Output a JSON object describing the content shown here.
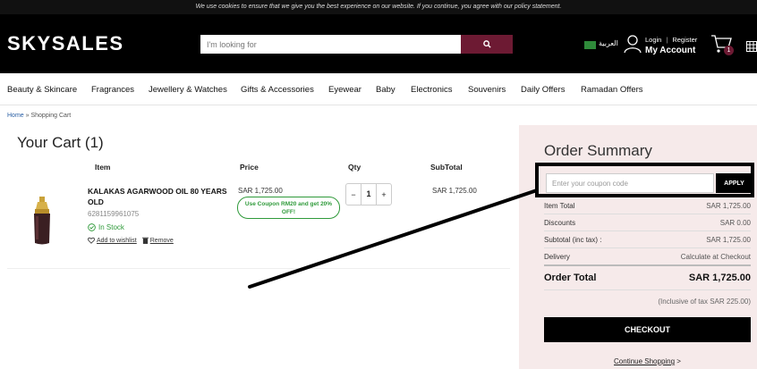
{
  "cookie_notice": "We use cookies to ensure that we give you the best experience on our website. If you continue, you agree with our policy statement.",
  "header": {
    "logo": "SKYSALES",
    "search_placeholder": "I'm looking for",
    "language": "العربية",
    "login": "Login",
    "register": "Register",
    "my_account": "My Account",
    "cart_count": "1"
  },
  "nav": [
    "Beauty & Skincare",
    "Fragrances",
    "Jewellery & Watches",
    "Gifts & Accessories",
    "Eyewear",
    "Baby",
    "Electronics",
    "Souvenirs",
    "Daily Offers",
    "Ramadan Offers"
  ],
  "breadcrumb": {
    "home": "Home",
    "current": " » Shopping Cart"
  },
  "cart": {
    "title": "Your Cart (1)",
    "headers": {
      "item": "Item",
      "price": "Price",
      "qty": "Qty",
      "subtotal": "SubTotal"
    },
    "item": {
      "name": "KALAKAS AGARWOOD OIL 80 YEARS OLD",
      "sku": "6281159961075",
      "stock": "In Stock",
      "wishlist": "Add to wishlist",
      "remove": "Remove",
      "price": "SAR 1,725.00",
      "coupon": "Use Coupon RM20 and get 20% OFF!",
      "qty_minus": "−",
      "qty": "1",
      "qty_plus": "+",
      "subtotal": "SAR 1,725.00"
    }
  },
  "summary": {
    "title": "Order Summary",
    "coupon_placeholder": "Enter your coupon code",
    "apply": "APPLY",
    "rows": [
      {
        "label": "Item Total",
        "value": "SAR 1,725.00"
      },
      {
        "label": "Discounts",
        "value": "SAR 0.00"
      },
      {
        "label": "Subtotal (inc tax) :",
        "value": "SAR 1,725.00"
      },
      {
        "label": "Delivery",
        "value": "Calculate at Checkout"
      }
    ],
    "total_label": "Order Total",
    "total_value": "SAR 1,725.00",
    "tax_note": "(Inclusive of tax SAR 225.00)",
    "checkout": "CHECKOUT",
    "continue": "Continue Shopping",
    "continue_arrow": " >"
  },
  "colors": {
    "brand": "#6d1a33",
    "stock_green": "#2f9a3a",
    "summary_bg": "#f6eaea"
  }
}
